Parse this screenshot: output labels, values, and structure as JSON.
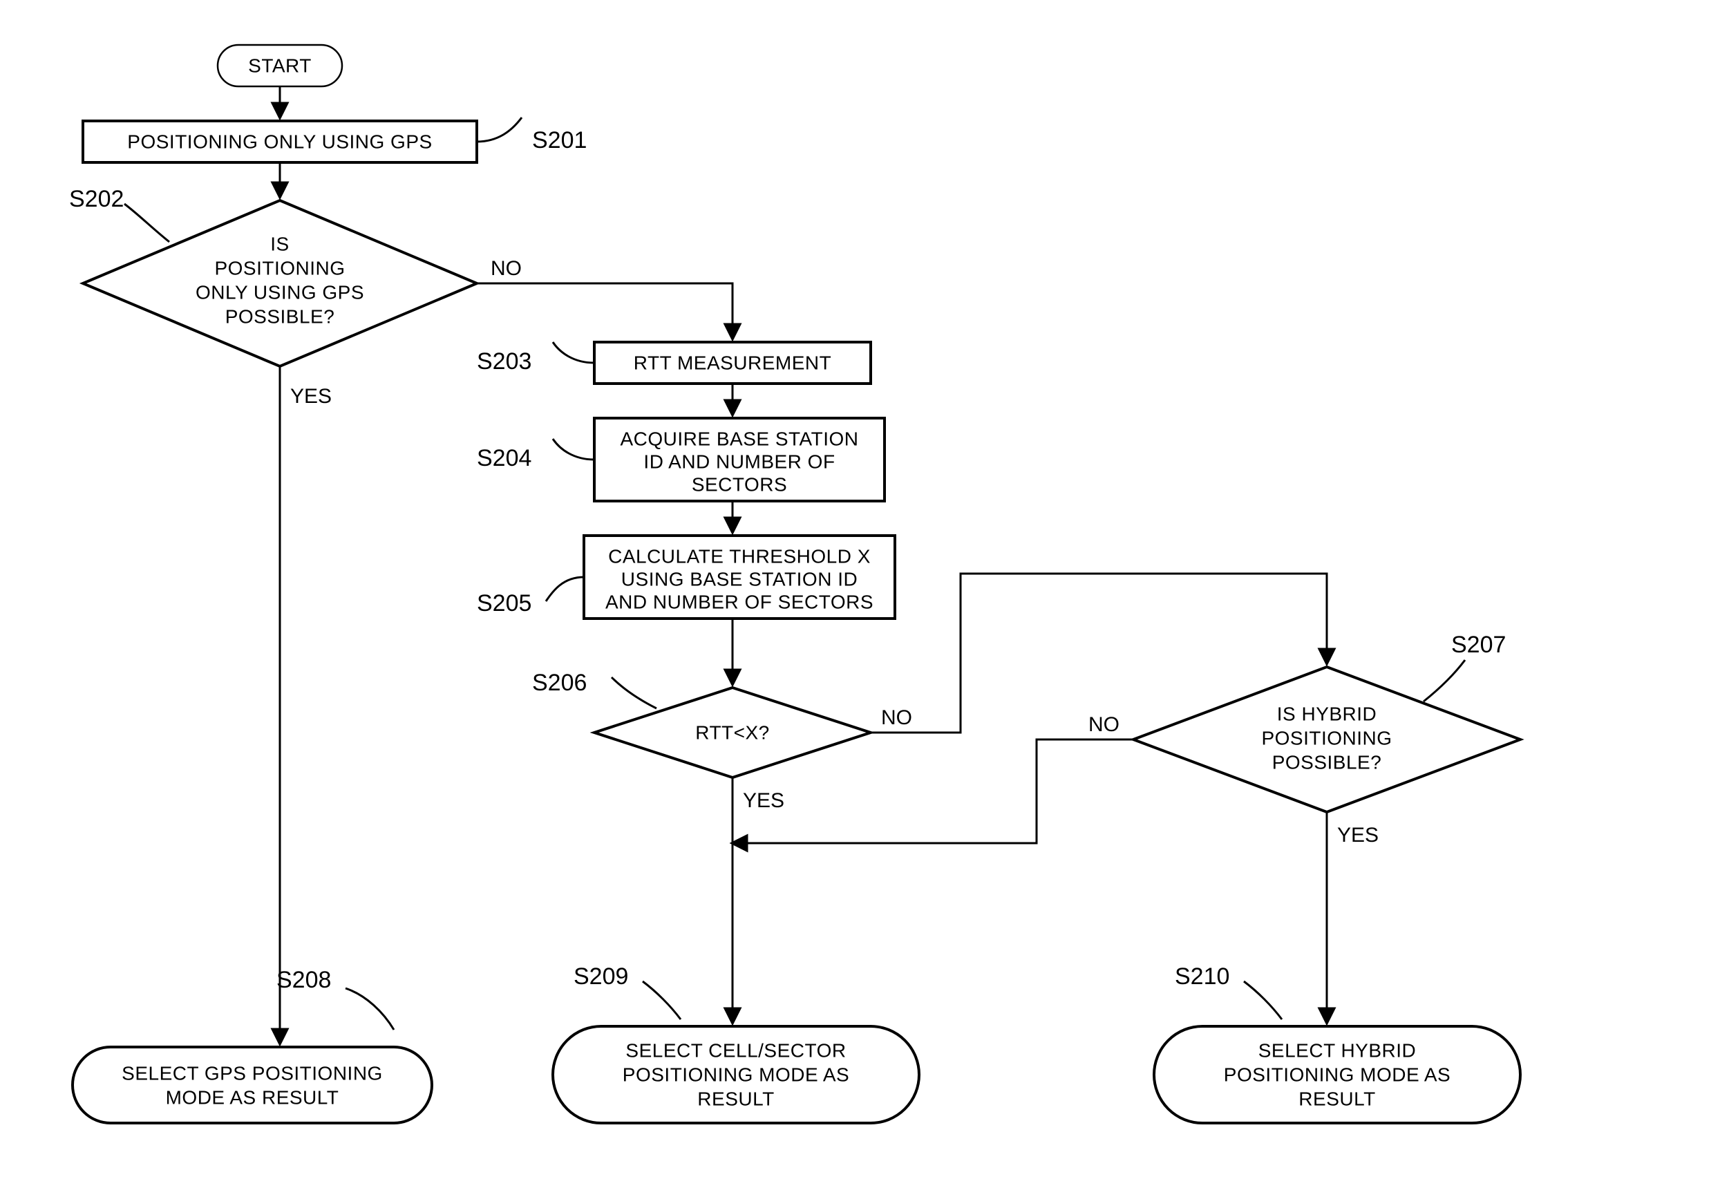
{
  "nodes": {
    "start": {
      "text": "START"
    },
    "s201": {
      "label": "S201",
      "text": "POSITIONING ONLY USING GPS"
    },
    "s202": {
      "label": "S202",
      "lines": [
        "IS",
        "POSITIONING",
        "ONLY USING GPS",
        "POSSIBLE?"
      ]
    },
    "s203": {
      "label": "S203",
      "text": "RTT MEASUREMENT"
    },
    "s204": {
      "label": "S204",
      "lines": [
        "ACQUIRE BASE STATION",
        "ID AND NUMBER OF",
        "SECTORS"
      ]
    },
    "s205": {
      "label": "S205",
      "lines": [
        "CALCULATE THRESHOLD X",
        "USING BASE STATION ID",
        "AND NUMBER OF SECTORS"
      ]
    },
    "s206": {
      "label": "S206",
      "text": "RTT<X?"
    },
    "s207": {
      "label": "S207",
      "lines": [
        "IS HYBRID",
        "POSITIONING",
        "POSSIBLE?"
      ]
    },
    "s208": {
      "label": "S208",
      "lines": [
        "SELECT GPS POSITIONING",
        "MODE AS RESULT"
      ]
    },
    "s209": {
      "label": "S209",
      "lines": [
        "SELECT CELL/SECTOR",
        "POSITIONING MODE AS",
        "RESULT"
      ]
    },
    "s210": {
      "label": "S210",
      "lines": [
        "SELECT HYBRID",
        "POSITIONING MODE AS",
        "RESULT"
      ]
    }
  },
  "edges": {
    "yes": "YES",
    "no": "NO"
  }
}
